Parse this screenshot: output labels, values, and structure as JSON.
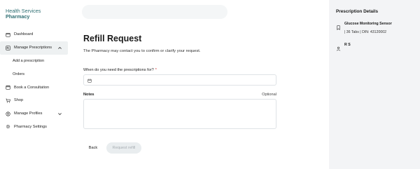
{
  "brand": {
    "org": "Health Services",
    "app": "Pharmacy"
  },
  "sidebar": {
    "items": [
      {
        "label": "Dashboard",
        "icon": "calendar-icon"
      },
      {
        "label": "Manage Prescriptions",
        "icon": "prescription-icon",
        "expanded": true,
        "children": [
          {
            "label": "Add a prescription"
          },
          {
            "label": "Orders"
          }
        ]
      },
      {
        "label": "Book a Consultation",
        "icon": "calendar-icon"
      },
      {
        "label": "Shop",
        "icon": "cart-icon"
      },
      {
        "label": "Manage Profiles",
        "icon": "profiles-icon",
        "expanded": false
      },
      {
        "label": "Pharmacy Settings",
        "icon": "gear-icon"
      }
    ]
  },
  "main": {
    "title": "Refill Request",
    "subtitle": "The Pharmacy may contact you to confirm or clarify your request.",
    "date_question": "When do you need the prescriptions for?",
    "required_mark": "*",
    "date_value": "",
    "notes_label": "Notes",
    "notes_optional": "Optional",
    "notes_value": "",
    "back_label": "Back",
    "refill_label": "Request refill"
  },
  "details": {
    "title": "Prescription Details",
    "medication": "Glucose Monitoring Sensor",
    "medication_detail": "| 36 Tabs | DIN: 43120002",
    "patient": "R S"
  },
  "colors": {
    "brand": "#2f6f73",
    "required": "#d63a3a",
    "panel_bg": "#f3f4f6",
    "active_bg": "#eef1f2"
  }
}
